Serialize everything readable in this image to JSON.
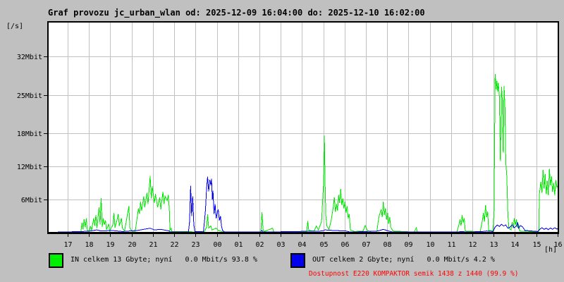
{
  "title": "Graf provozu jc_urban_wlan od: 2025-12-09 16:04:00 do: 2025-12-10 16:02:00",
  "axes": {
    "y_unit": "[/s]",
    "x_unit": "[h]"
  },
  "legend": {
    "in": {
      "swatch_color": "#00ee00",
      "label": "IN celkem 13 Gbyte; nyní   0.0 Mbit/s 93.8 %"
    },
    "out": {
      "swatch_color": "#0000ee",
      "label": "OUT celkem 2 Gbyte; nyní   0.0 Mbit/s 4.2 %"
    },
    "availability": {
      "label": "Dostupnost E220 KOMPAKTOR semik 1438 z 1440 (99.9 %)",
      "color": "#ff0000"
    }
  },
  "chart_data": {
    "type": "line",
    "title": "Graf provozu jc_urban_wlan od: 2025-12-09 16:04:00 do: 2025-12-10 16:02:00",
    "xlabel": "[h]",
    "ylabel": "[/s]",
    "grid": true,
    "legend_position": "bottom",
    "xlim": [
      0,
      23.97
    ],
    "ylim": [
      0,
      38.25
    ],
    "x_unit": "hours since 16:04",
    "first_hour_tick_offset_h": 0.93,
    "hour_labels": [
      "17",
      "18",
      "19",
      "20",
      "21",
      "22",
      "23",
      "00",
      "01",
      "02",
      "03",
      "04",
      "05",
      "06",
      "07",
      "08",
      "09",
      "10",
      "11",
      "12",
      "13",
      "14",
      "15",
      "16"
    ],
    "y_ticks": [
      {
        "label": "6Mbit",
        "value": 6
      },
      {
        "label": "12Mbit",
        "value": 12
      },
      {
        "label": "18Mbit",
        "value": 18
      },
      {
        "label": "25Mbit",
        "value": 25
      },
      {
        "label": "32Mbit",
        "value": 32
      }
    ],
    "series": [
      {
        "name": "IN",
        "unit": "Mbit/s",
        "color": "#00e600",
        "points": [
          [
            0,
            0.05
          ],
          [
            1.55,
            0.1
          ],
          [
            1.6,
            1.8
          ],
          [
            1.65,
            0.6
          ],
          [
            1.7,
            2.4
          ],
          [
            1.75,
            1
          ],
          [
            1.8,
            2.6
          ],
          [
            1.85,
            0.4
          ],
          [
            1.95,
            0.3
          ],
          [
            2,
            1.2
          ],
          [
            2.05,
            0.4
          ],
          [
            2.15,
            2.6
          ],
          [
            2.2,
            1.2
          ],
          [
            2.25,
            3.2
          ],
          [
            2.3,
            0.8
          ],
          [
            2.4,
            4.6
          ],
          [
            2.45,
            1.5
          ],
          [
            2.5,
            6.3
          ],
          [
            2.55,
            1
          ],
          [
            2.6,
            2.6
          ],
          [
            2.65,
            1.4
          ],
          [
            2.7,
            2.2
          ],
          [
            2.75,
            0.5
          ],
          [
            2.85,
            1.6
          ],
          [
            2.9,
            0.3
          ],
          [
            3.05,
            1.4
          ],
          [
            3.1,
            3.6
          ],
          [
            3.15,
            0.9
          ],
          [
            3.25,
            2.4
          ],
          [
            3.3,
            3.4
          ],
          [
            3.35,
            1.2
          ],
          [
            3.45,
            2.6
          ],
          [
            3.5,
            0.8
          ],
          [
            3.6,
            0.3
          ],
          [
            3.8,
            4.8
          ],
          [
            3.85,
            0.8
          ],
          [
            3.95,
            0.3
          ],
          [
            4.1,
            0.2
          ],
          [
            4.2,
            3
          ],
          [
            4.25,
            4.4
          ],
          [
            4.3,
            3.4
          ],
          [
            4.35,
            5.6
          ],
          [
            4.4,
            4
          ],
          [
            4.5,
            6.6
          ],
          [
            4.55,
            4.6
          ],
          [
            4.65,
            7.2
          ],
          [
            4.7,
            5.2
          ],
          [
            4.8,
            10.3
          ],
          [
            4.85,
            6.2
          ],
          [
            4.9,
            8.4
          ],
          [
            5,
            5.4
          ],
          [
            5.05,
            7
          ],
          [
            5.15,
            4.6
          ],
          [
            5.25,
            6.4
          ],
          [
            5.3,
            4.2
          ],
          [
            5.4,
            7.4
          ],
          [
            5.45,
            5.2
          ],
          [
            5.5,
            6.6
          ],
          [
            5.6,
            5.8
          ],
          [
            5.65,
            6.8
          ],
          [
            5.7,
            4.2
          ],
          [
            5.73,
            0.4
          ],
          [
            5.78,
            0.8
          ],
          [
            5.82,
            0.2
          ],
          [
            6.9,
            0.15
          ],
          [
            7.35,
            0.2
          ],
          [
            7.45,
            1
          ],
          [
            7.5,
            3.3
          ],
          [
            7.55,
            0.8
          ],
          [
            7.65,
            1.2
          ],
          [
            7.7,
            0.5
          ],
          [
            7.9,
            0.8
          ],
          [
            8,
            0.4
          ],
          [
            8.2,
            0.15
          ],
          [
            10,
            0.1
          ],
          [
            10.05,
            3.7
          ],
          [
            10.1,
            0.6
          ],
          [
            10.15,
            0.2
          ],
          [
            10.55,
            0.8
          ],
          [
            10.6,
            0.15
          ],
          [
            12.15,
            0.1
          ],
          [
            12.2,
            2.1
          ],
          [
            12.25,
            0.4
          ],
          [
            12.5,
            0.3
          ],
          [
            12.6,
            1.2
          ],
          [
            12.7,
            0.5
          ],
          [
            12.85,
            2
          ],
          [
            12.9,
            5.8
          ],
          [
            12.95,
            9.2
          ],
          [
            12.98,
            17.6
          ],
          [
            13.02,
            8
          ],
          [
            13.05,
            3
          ],
          [
            13.1,
            1.2
          ],
          [
            13.2,
            0.6
          ],
          [
            13.3,
            2.2
          ],
          [
            13.4,
            4.6
          ],
          [
            13.45,
            6.4
          ],
          [
            13.5,
            3.8
          ],
          [
            13.55,
            5.2
          ],
          [
            13.6,
            4
          ],
          [
            13.65,
            6.8
          ],
          [
            13.7,
            5.4
          ],
          [
            13.75,
            7.9
          ],
          [
            13.8,
            5
          ],
          [
            13.85,
            6.2
          ],
          [
            13.9,
            4.4
          ],
          [
            13.95,
            5.6
          ],
          [
            14,
            3.6
          ],
          [
            14.05,
            4.8
          ],
          [
            14.1,
            2.6
          ],
          [
            14.15,
            3.4
          ],
          [
            14.2,
            0.5
          ],
          [
            14.4,
            0.2
          ],
          [
            14.8,
            0.3
          ],
          [
            14.9,
            1.3
          ],
          [
            15,
            0.4
          ],
          [
            15.1,
            0.2
          ],
          [
            15.45,
            0.3
          ],
          [
            15.5,
            1.8
          ],
          [
            15.55,
            3
          ],
          [
            15.65,
            4.2
          ],
          [
            15.7,
            2.8
          ],
          [
            15.75,
            5.6
          ],
          [
            15.8,
            3.2
          ],
          [
            15.85,
            4.4
          ],
          [
            15.9,
            2.4
          ],
          [
            15.95,
            3.6
          ],
          [
            16,
            1.6
          ],
          [
            16.05,
            2.8
          ],
          [
            16.1,
            1
          ],
          [
            16.2,
            0.3
          ],
          [
            17.2,
            0.1
          ],
          [
            17.3,
            0.9
          ],
          [
            17.35,
            0.15
          ],
          [
            19.2,
            0.1
          ],
          [
            19.3,
            1.4
          ],
          [
            19.35,
            2.4
          ],
          [
            19.4,
            1.2
          ],
          [
            19.45,
            3.2
          ],
          [
            19.5,
            1.8
          ],
          [
            19.55,
            2.6
          ],
          [
            19.6,
            0.3
          ],
          [
            20.3,
            0.15
          ],
          [
            20.4,
            2.2
          ],
          [
            20.45,
            3.6
          ],
          [
            20.5,
            2
          ],
          [
            20.55,
            5
          ],
          [
            20.6,
            2.8
          ],
          [
            20.65,
            3.8
          ],
          [
            20.7,
            0.4
          ],
          [
            20.9,
            0.3
          ],
          [
            20.95,
            4
          ],
          [
            21,
            28.8
          ],
          [
            21.05,
            26
          ],
          [
            21.08,
            27.6
          ],
          [
            21.12,
            25.5
          ],
          [
            21.15,
            27.2
          ],
          [
            21.2,
            24.8
          ],
          [
            21.25,
            13
          ],
          [
            21.3,
            26.5
          ],
          [
            21.33,
            24.5
          ],
          [
            21.38,
            14.5
          ],
          [
            21.42,
            26.6
          ],
          [
            21.47,
            22
          ],
          [
            21.5,
            12.8
          ],
          [
            21.55,
            10.2
          ],
          [
            21.6,
            3.2
          ],
          [
            21.65,
            0.8
          ],
          [
            21.75,
            0.5
          ],
          [
            21.8,
            1.9
          ],
          [
            21.85,
            0.8
          ],
          [
            21.9,
            2.6
          ],
          [
            21.95,
            1.4
          ],
          [
            22,
            2.4
          ],
          [
            22.05,
            0.9
          ],
          [
            22.1,
            1.6
          ],
          [
            22.15,
            0.3
          ],
          [
            23,
            0.15
          ],
          [
            23.05,
            0.1
          ],
          [
            23.08,
            7
          ],
          [
            23.15,
            9.2
          ],
          [
            23.2,
            7.2
          ],
          [
            23.25,
            11.4
          ],
          [
            23.3,
            8
          ],
          [
            23.35,
            10.6
          ],
          [
            23.4,
            7
          ],
          [
            23.45,
            9.4
          ],
          [
            23.5,
            6.8
          ],
          [
            23.55,
            11.6
          ],
          [
            23.6,
            8.6
          ],
          [
            23.65,
            10.2
          ],
          [
            23.7,
            7.4
          ],
          [
            23.75,
            9
          ],
          [
            23.8,
            6.8
          ],
          [
            23.85,
            9.6
          ],
          [
            23.9,
            8.2
          ],
          [
            23.97,
            8.8
          ]
        ]
      },
      {
        "name": "OUT",
        "unit": "Mbit/s",
        "color": "#0000ee",
        "points": [
          [
            0,
            0.05
          ],
          [
            1.6,
            0.2
          ],
          [
            2,
            0.3
          ],
          [
            2.3,
            0.5
          ],
          [
            2.5,
            0.3
          ],
          [
            3,
            0.4
          ],
          [
            3.5,
            0.2
          ],
          [
            4.2,
            0.4
          ],
          [
            4.5,
            0.6
          ],
          [
            4.8,
            0.8
          ],
          [
            5,
            0.5
          ],
          [
            5.3,
            0.6
          ],
          [
            5.7,
            0.3
          ],
          [
            5.75,
            0.1
          ],
          [
            6.6,
            0.1
          ],
          [
            6.65,
            2
          ],
          [
            6.7,
            8.5
          ],
          [
            6.75,
            3
          ],
          [
            6.8,
            6.6
          ],
          [
            6.85,
            1.5
          ],
          [
            6.9,
            0.2
          ],
          [
            7.3,
            0.15
          ],
          [
            7.35,
            2
          ],
          [
            7.4,
            4.2
          ],
          [
            7.45,
            8
          ],
          [
            7.5,
            10.2
          ],
          [
            7.55,
            7.5
          ],
          [
            7.6,
            9.6
          ],
          [
            7.65,
            8.6
          ],
          [
            7.68,
            9.8
          ],
          [
            7.72,
            6
          ],
          [
            7.75,
            7.6
          ],
          [
            7.8,
            3.4
          ],
          [
            7.85,
            5.2
          ],
          [
            7.9,
            2.6
          ],
          [
            7.95,
            3.6
          ],
          [
            8,
            4.2
          ],
          [
            8.05,
            2.2
          ],
          [
            8.1,
            3
          ],
          [
            8.15,
            1.2
          ],
          [
            8.2,
            0.4
          ],
          [
            8.3,
            0.1
          ],
          [
            10,
            0.15
          ],
          [
            10.05,
            0.4
          ],
          [
            10.1,
            0.1
          ],
          [
            12.9,
            0.3
          ],
          [
            13,
            0.5
          ],
          [
            13.4,
            0.4
          ],
          [
            14,
            0.3
          ],
          [
            14.2,
            0.1
          ],
          [
            15.5,
            0.3
          ],
          [
            15.75,
            0.6
          ],
          [
            16,
            0.3
          ],
          [
            16.2,
            0.1
          ],
          [
            19.3,
            0.15
          ],
          [
            19.5,
            0.2
          ],
          [
            19.6,
            0.1
          ],
          [
            20.4,
            0.2
          ],
          [
            20.6,
            0.3
          ],
          [
            20.9,
            0.2
          ],
          [
            21,
            1
          ],
          [
            21.1,
            1.4
          ],
          [
            21.2,
            1.1
          ],
          [
            21.3,
            1.5
          ],
          [
            21.4,
            1.2
          ],
          [
            21.5,
            1.4
          ],
          [
            21.6,
            0.8
          ],
          [
            21.7,
            1
          ],
          [
            21.8,
            1.4
          ],
          [
            21.9,
            0.9
          ],
          [
            22,
            1.2
          ],
          [
            22.05,
            1.9
          ],
          [
            22.1,
            0.8
          ],
          [
            22.2,
            1.3
          ],
          [
            22.3,
            1
          ],
          [
            22.4,
            0.4
          ],
          [
            23,
            0.2
          ],
          [
            23.1,
            0.6
          ],
          [
            23.2,
            0.9
          ],
          [
            23.3,
            0.6
          ],
          [
            23.4,
            0.8
          ],
          [
            23.5,
            0.55
          ],
          [
            23.6,
            0.85
          ],
          [
            23.7,
            0.6
          ],
          [
            23.8,
            0.9
          ],
          [
            23.9,
            0.65
          ],
          [
            23.97,
            0.8
          ]
        ]
      }
    ]
  }
}
